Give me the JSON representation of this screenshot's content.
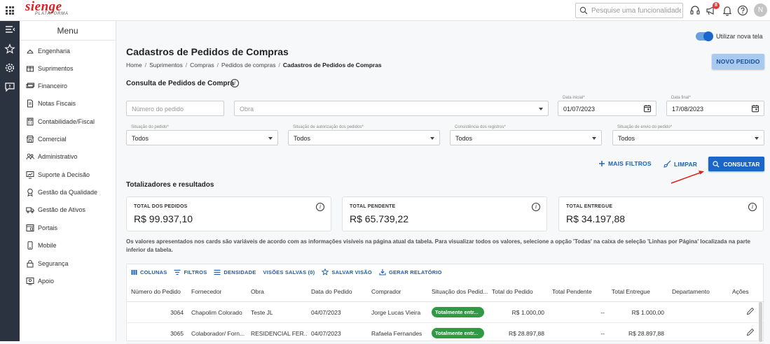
{
  "topbar": {
    "logo_main": "sienge",
    "logo_sub": "PLATAFORMA",
    "search_placeholder": "Pesquise uma funcionalidade.",
    "notification_count": "8",
    "avatar_initial": "N"
  },
  "menu": {
    "title": "Menu",
    "items": [
      {
        "label": "Engenharia",
        "icon": "hardhat-icon"
      },
      {
        "label": "Suprimentos",
        "icon": "box-icon"
      },
      {
        "label": "Financeiro",
        "icon": "money-icon"
      },
      {
        "label": "Notas Fiscais",
        "icon": "document-icon"
      },
      {
        "label": "Contabilidade/Fiscal",
        "icon": "calculator-icon"
      },
      {
        "label": "Comercial",
        "icon": "shop-icon"
      },
      {
        "label": "Administrativo",
        "icon": "users-icon"
      },
      {
        "label": "Suporte à Decisão",
        "icon": "chart-icon"
      },
      {
        "label": "Gestão da Qualidade",
        "icon": "medal-icon"
      },
      {
        "label": "Gestão de Ativos",
        "icon": "truck-icon"
      },
      {
        "label": "Portais",
        "icon": "portal-icon"
      },
      {
        "label": "Mobile",
        "icon": "mobile-icon"
      },
      {
        "label": "Segurança",
        "icon": "lock-icon"
      },
      {
        "label": "Apoio",
        "icon": "support-icon"
      }
    ]
  },
  "header": {
    "toggle_label": "Utilizar nova tela",
    "toggle_on": true,
    "title": "Cadastros de Pedidos de Compras",
    "breadcrumb": [
      "Home",
      "Suprimentos",
      "Compras",
      "Pedidos de compras",
      "Cadastros de Pedidos de Compras"
    ],
    "new_button": "NOVO PEDIDO"
  },
  "filters": {
    "section_title": "Consulta de Pedidos de Compra",
    "order_number_placeholder": "Número do pedido",
    "obra_placeholder": "Obra",
    "start_date_label": "Data inicial*",
    "start_date": "01/07/2023",
    "end_date_label": "Data final*",
    "end_date": "17/08/2023",
    "status_label": "Situação do pedido*",
    "status_value": "Todos",
    "auth_label": "Situação de autorização dos pedidos*",
    "auth_value": "Todos",
    "consistency_label": "Consistência dos registros*",
    "consistency_value": "Todos",
    "send_label": "Situação de envio do pedido*",
    "send_value": "Todos",
    "more_filters": "MAIS FILTROS",
    "clear": "LIMPAR",
    "search_button": "CONSULTAR"
  },
  "totals": {
    "heading": "Totalizadores e resultados",
    "cards": [
      {
        "label": "TOTAL DOS PEDIDOS",
        "value": "R$ 99.937,10"
      },
      {
        "label": "TOTAL PENDENTE",
        "value": "R$ 65.739,22"
      },
      {
        "label": "TOTAL ENTREGUE",
        "value": "R$ 34.197,88"
      }
    ],
    "note": "Os valores apresentados nos cards são variáveis de acordo com as informações visíveis na página atual da tabela. Para visualizar todos os valores, selecione a opção 'Todas' na caixa de seleção 'Linhas por Página' localizada na parte inferior da tabela."
  },
  "table": {
    "toolbar": [
      "COLUNAS",
      "FILTROS",
      "DENSIDADE",
      "VISÕES SALVAS (0)",
      "SALVAR VISÃO",
      "GERAR RELATÓRIO"
    ],
    "columns": [
      "Número do Pedido",
      "Fornecedor",
      "Obra",
      "Data do Pedido",
      "Comprador",
      "Situação dos Pedid...",
      "Total do Pedido",
      "Total Pendente",
      "Total Entregue",
      "Departamento",
      "Ações"
    ],
    "rows": [
      {
        "numero": "3064",
        "fornecedor": "Chapolim Colorado",
        "obra": "Teste JL",
        "data": "04/07/2023",
        "comprador": "Jorge Lucas Vieira",
        "situacao": "Totalmente entr...",
        "total": "R$ 1.000,00",
        "pendente": "--",
        "entregue": "R$ 1.000,00"
      },
      {
        "numero": "3065",
        "fornecedor": "Colaborador/ Forn...",
        "obra": "RESIDENCIAL FER...",
        "data": "04/07/2023",
        "comprador": "Rafaela Fernandes",
        "situacao": "Totalmente entr...",
        "total": "R$ 28.897,88",
        "pendente": "--",
        "entregue": "R$ 28.897,88"
      }
    ],
    "status_color": "#2e9a44"
  },
  "colors": {
    "primary": "#1a66c9",
    "brand": "#d6231e",
    "sidebar": "#2b3340"
  }
}
